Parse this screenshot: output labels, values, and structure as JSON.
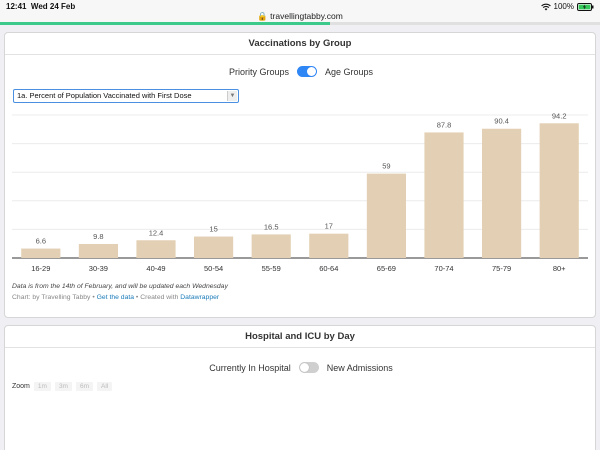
{
  "status_bar": {
    "time": "12:41",
    "date": "Wed 24 Feb",
    "url": "travellingtabby.com",
    "battery": "100%"
  },
  "page_load_progress": 0.55,
  "vaccinations": {
    "title": "Vaccinations by Group",
    "toggle_left": "Priority Groups",
    "toggle_right": "Age Groups",
    "dropdown_value": "1a. Percent of Population Vaccinated with First Dose",
    "note": "Data is from the 14th of February, and will be updated each Wednesday",
    "credit_prefix": "Chart: by Travelling Tabby • ",
    "credit_link1": "Get the data",
    "credit_mid": " • Created with ",
    "credit_link2": "Datawrapper"
  },
  "hospital": {
    "title": "Hospital and ICU by Day",
    "toggle_left": "Currently In Hospital",
    "toggle_right": "New Admissions",
    "zoom_label": "Zoom",
    "zoom_buttons": [
      "1m",
      "3m",
      "6m",
      "All"
    ]
  },
  "colors": {
    "bar": "#e3cfb3",
    "toggle_on": "#2f86f5",
    "progress": "#3cc98c"
  },
  "chart_data": {
    "type": "bar",
    "categories": [
      "16-29",
      "30-39",
      "40-49",
      "50-54",
      "55-59",
      "60-64",
      "65-69",
      "70-74",
      "75-79",
      "80+"
    ],
    "values": [
      6.6,
      9.8,
      12.4,
      15,
      16.5,
      17,
      59,
      87.8,
      90.4,
      94.2
    ],
    "value_labels": [
      "6.6",
      "9.8",
      "12.4",
      "15",
      "16.5",
      "17",
      "59",
      "87.8",
      "90.4",
      "94.2"
    ],
    "ylim": [
      0,
      100
    ],
    "grid": true
  }
}
